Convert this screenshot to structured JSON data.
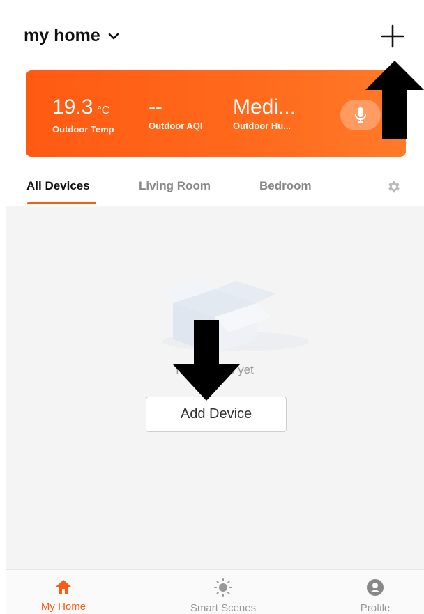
{
  "header": {
    "home_name": "my home",
    "add_icon": "plus-icon",
    "dropdown_icon": "chevron-down-icon"
  },
  "weather": {
    "temp_value": "19.3",
    "temp_unit": "°C",
    "temp_label": "Outdoor Temp",
    "aqi_value": "--",
    "aqi_label": "Outdoor AQI",
    "humidity_value": "Medi...",
    "humidity_label": "Outdoor Hu...",
    "mic_icon": "microphone-icon",
    "accent_color": "#ff5a12"
  },
  "tabs": {
    "items": [
      {
        "label": "All Devices",
        "active": true
      },
      {
        "label": "Living Room",
        "active": false
      },
      {
        "label": "Bedroom",
        "active": false
      }
    ],
    "settings_icon": "gear-icon"
  },
  "empty_state": {
    "text": "No devices yet",
    "illustration_icon": "open-box-icon",
    "add_button_label": "Add Device"
  },
  "bottom_nav": {
    "items": [
      {
        "label": "My Home",
        "icon": "house-icon",
        "active": true
      },
      {
        "label": "Smart Scenes",
        "icon": "sun-icon",
        "active": false
      },
      {
        "label": "Profile",
        "icon": "person-icon",
        "active": false
      }
    ]
  }
}
